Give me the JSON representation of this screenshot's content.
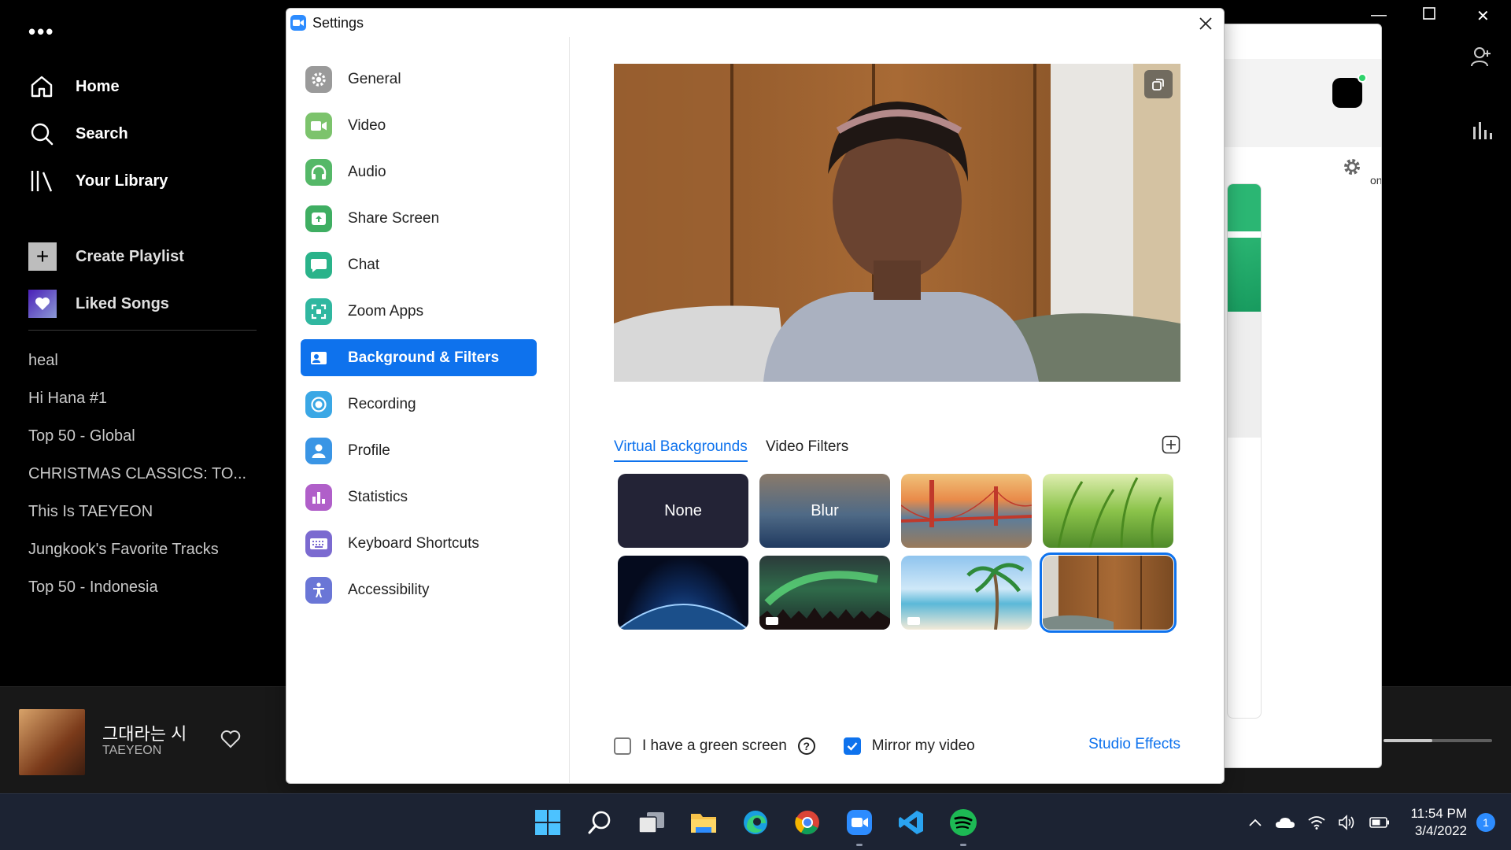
{
  "spotify": {
    "nav": [
      {
        "label": "Home",
        "icon": "home-icon"
      },
      {
        "label": "Search",
        "icon": "search-icon"
      },
      {
        "label": "Your Library",
        "icon": "library-icon"
      }
    ],
    "create_playlist_label": "Create Playlist",
    "liked_songs_label": "Liked Songs",
    "playlists": [
      "heal",
      "Hi Hana #1",
      "Top 50 - Global",
      "CHRISTMAS CLASSICS: TO...",
      "This Is TAEYEON",
      "Jungkook's Favorite Tracks",
      "Top 50 - Indonesia"
    ],
    "now_playing": {
      "title": "그대라는 시",
      "artist": "TAEYEON",
      "volume_fraction": 0.45
    }
  },
  "zoom_main": {
    "partial_label": "on"
  },
  "settings": {
    "window_title": "Settings",
    "menu": [
      {
        "label": "General",
        "icon": "gear-icon",
        "color": "#8e8e8e"
      },
      {
        "label": "Video",
        "icon": "video-camera-icon",
        "color": "#7cc36c"
      },
      {
        "label": "Audio",
        "icon": "headphones-icon",
        "color": "#55b868"
      },
      {
        "label": "Share Screen",
        "icon": "share-screen-icon",
        "color": "#3fae62"
      },
      {
        "label": "Chat",
        "icon": "chat-icon",
        "color": "#2ab38a"
      },
      {
        "label": "Zoom Apps",
        "icon": "apps-icon",
        "color": "#30b7a0"
      },
      {
        "label": "Background & Filters",
        "icon": "portrait-icon",
        "color": "#0e72ed"
      },
      {
        "label": "Recording",
        "icon": "record-icon",
        "color": "#3aa7e5"
      },
      {
        "label": "Profile",
        "icon": "profile-icon",
        "color": "#3a95e5"
      },
      {
        "label": "Statistics",
        "icon": "statistics-icon",
        "color": "#b05fc9"
      },
      {
        "label": "Keyboard Shortcuts",
        "icon": "keyboard-icon",
        "color": "#7b6ad0"
      },
      {
        "label": "Accessibility",
        "icon": "accessibility-icon",
        "color": "#6a76d6"
      }
    ],
    "active_menu_index": 6,
    "tabs": [
      "Virtual Backgrounds",
      "Video Filters"
    ],
    "active_tab": "Virtual Backgrounds",
    "backgrounds": [
      {
        "label": "None",
        "kind": "none"
      },
      {
        "label": "Blur",
        "kind": "blur"
      },
      {
        "label": "",
        "kind": "golden-gate"
      },
      {
        "label": "",
        "kind": "grass"
      },
      {
        "label": "",
        "kind": "earth"
      },
      {
        "label": "",
        "kind": "aurora",
        "video": true
      },
      {
        "label": "",
        "kind": "beach",
        "video": true
      },
      {
        "label": "",
        "kind": "custom-room",
        "selected": true
      }
    ],
    "green_screen_label": "I have a green screen",
    "green_screen_checked": false,
    "mirror_label": "Mirror my video",
    "mirror_checked": true,
    "studio_effects_label": "Studio Effects"
  },
  "taskbar": {
    "apps": [
      "windows-start-icon",
      "search-icon",
      "task-view-icon",
      "file-explorer-icon",
      "edge-icon",
      "chrome-icon",
      "zoom-icon",
      "vscode-icon",
      "spotify-icon"
    ],
    "time": "11:54 PM",
    "date": "3/4/2022",
    "notification_count": "1"
  },
  "colors": {
    "accent": "#0e72ed",
    "spotify_green": "#1db954"
  }
}
